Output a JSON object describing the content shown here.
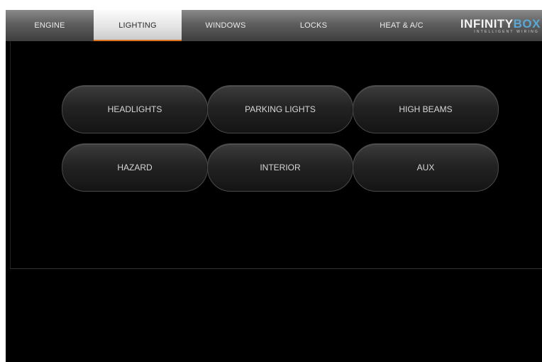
{
  "tabs": [
    {
      "label": "ENGINE",
      "active": false
    },
    {
      "label": "LIGHTING",
      "active": true
    },
    {
      "label": "WINDOWS",
      "active": false
    },
    {
      "label": "LOCKS",
      "active": false
    },
    {
      "label": "HEAT & A/C",
      "active": false
    }
  ],
  "brand": {
    "name_main": "INFINITY",
    "name_accent": "BOX",
    "tagline": "INTELLIGENT WIRING"
  },
  "lighting_buttons": [
    {
      "label": "HEADLIGHTS"
    },
    {
      "label": "PARKING LIGHTS"
    },
    {
      "label": "HIGH BEAMS"
    },
    {
      "label": "HAZARD"
    },
    {
      "label": "INTERIOR"
    },
    {
      "label": "AUX"
    }
  ],
  "colors": {
    "accent": "#d9731f",
    "brand_accent": "#5aa8d6",
    "background": "#000000"
  }
}
